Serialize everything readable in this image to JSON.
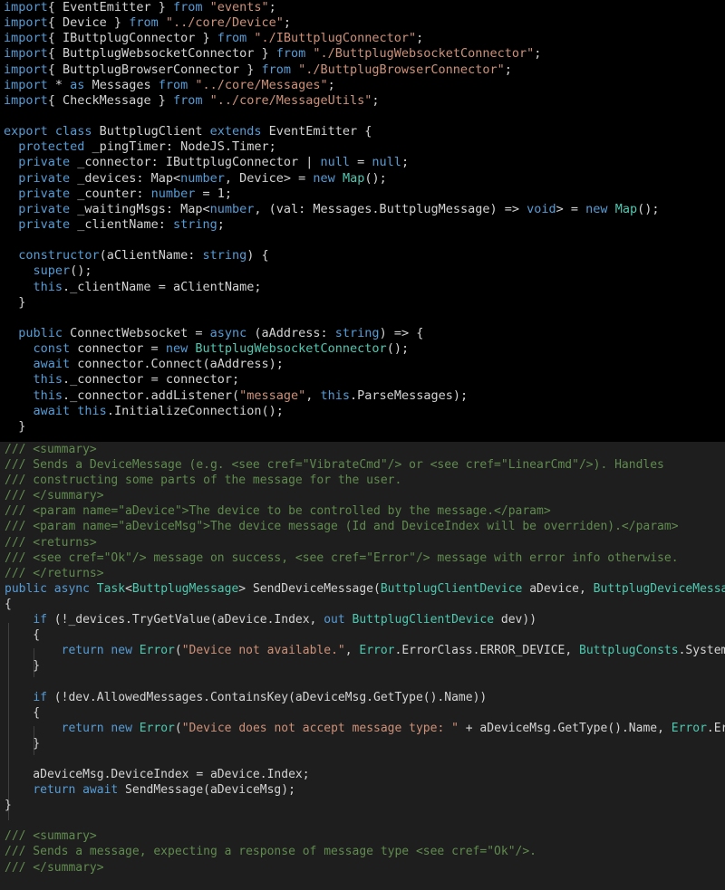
{
  "typescript": {
    "lines": [
      [
        [
          "kw",
          "import"
        ],
        [
          "",
          "{ EventEmitter } "
        ],
        [
          "kw",
          "from"
        ],
        [
          "str",
          " \"events\""
        ],
        [
          "",
          ";"
        ]
      ],
      [
        [
          "kw",
          "import"
        ],
        [
          "",
          "{ Device } "
        ],
        [
          "kw",
          "from"
        ],
        [
          "str",
          " \"../core/Device\""
        ],
        [
          "",
          ";"
        ]
      ],
      [
        [
          "kw",
          "import"
        ],
        [
          "",
          "{ IButtplugConnector } "
        ],
        [
          "kw",
          "from"
        ],
        [
          "str",
          " \"./IButtplugConnector\""
        ],
        [
          "",
          ";"
        ]
      ],
      [
        [
          "kw",
          "import"
        ],
        [
          "",
          "{ ButtplugWebsocketConnector } "
        ],
        [
          "kw",
          "from"
        ],
        [
          "str",
          " \"./ButtplugWebsocketConnector\""
        ],
        [
          "",
          ";"
        ]
      ],
      [
        [
          "kw",
          "import"
        ],
        [
          "",
          "{ ButtplugBrowserConnector } "
        ],
        [
          "kw",
          "from"
        ],
        [
          "str",
          " \"./ButtplugBrowserConnector\""
        ],
        [
          "",
          ";"
        ]
      ],
      [
        [
          "kw",
          "import"
        ],
        [
          "",
          " * "
        ],
        [
          "kw",
          "as"
        ],
        [
          "",
          " Messages "
        ],
        [
          "kw",
          "from"
        ],
        [
          "str",
          " \"../core/Messages\""
        ],
        [
          "",
          ";"
        ]
      ],
      [
        [
          "kw",
          "import"
        ],
        [
          "",
          "{ CheckMessage } "
        ],
        [
          "kw",
          "from"
        ],
        [
          "str",
          " \"../core/MessageUtils\""
        ],
        [
          "",
          ";"
        ]
      ],
      [],
      [
        [
          "kw",
          "export class"
        ],
        [
          "",
          " ButtplugClient "
        ],
        [
          "kw",
          "extends"
        ],
        [
          "",
          " EventEmitter {"
        ]
      ],
      [
        [
          "",
          "  "
        ],
        [
          "kw",
          "protected"
        ],
        [
          "",
          " _pingTimer: NodeJS.Timer;"
        ]
      ],
      [
        [
          "",
          "  "
        ],
        [
          "kw",
          "private"
        ],
        [
          "",
          " _connector: IButtplugConnector | "
        ],
        [
          "kw",
          "null"
        ],
        [
          "",
          " = "
        ],
        [
          "kw",
          "null"
        ],
        [
          "",
          ";"
        ]
      ],
      [
        [
          "",
          "  "
        ],
        [
          "kw",
          "private"
        ],
        [
          "",
          " _devices: Map<"
        ],
        [
          "kw",
          "number"
        ],
        [
          "",
          ", Device> = "
        ],
        [
          "kw",
          "new"
        ],
        [
          "",
          " "
        ],
        [
          "ty",
          "Map"
        ],
        [
          "",
          "();"
        ]
      ],
      [
        [
          "",
          "  "
        ],
        [
          "kw",
          "private"
        ],
        [
          "",
          " _counter: "
        ],
        [
          "kw",
          "number"
        ],
        [
          "",
          " = 1;"
        ]
      ],
      [
        [
          "",
          "  "
        ],
        [
          "kw",
          "private"
        ],
        [
          "",
          " _waitingMsgs: Map<"
        ],
        [
          "kw",
          "number"
        ],
        [
          "",
          ", (val: Messages.ButtplugMessage) => "
        ],
        [
          "kw",
          "void"
        ],
        [
          "",
          "> = "
        ],
        [
          "kw",
          "new"
        ],
        [
          "",
          " "
        ],
        [
          "ty",
          "Map"
        ],
        [
          "",
          "();"
        ]
      ],
      [
        [
          "",
          "  "
        ],
        [
          "kw",
          "private"
        ],
        [
          "",
          " _clientName: "
        ],
        [
          "kw",
          "string"
        ],
        [
          "",
          ";"
        ]
      ],
      [],
      [
        [
          "",
          "  "
        ],
        [
          "kw",
          "constructor"
        ],
        [
          "",
          "(aClientName: "
        ],
        [
          "kw",
          "string"
        ],
        [
          "",
          ") {"
        ]
      ],
      [
        [
          "",
          "    "
        ],
        [
          "kw",
          "super"
        ],
        [
          "",
          "();"
        ]
      ],
      [
        [
          "",
          "    "
        ],
        [
          "kw",
          "this"
        ],
        [
          "",
          "._clientName = aClientName;"
        ]
      ],
      [
        [
          "",
          "  }"
        ]
      ],
      [],
      [
        [
          "",
          "  "
        ],
        [
          "kw",
          "public"
        ],
        [
          "",
          " ConnectWebsocket = "
        ],
        [
          "kw",
          "async"
        ],
        [
          "",
          " (aAddress: "
        ],
        [
          "kw",
          "string"
        ],
        [
          "",
          ") => {"
        ]
      ],
      [
        [
          "",
          "    "
        ],
        [
          "kw",
          "const"
        ],
        [
          "",
          " connector = "
        ],
        [
          "kw",
          "new"
        ],
        [
          "",
          " "
        ],
        [
          "ty",
          "ButtplugWebsocketConnector"
        ],
        [
          "",
          "();"
        ]
      ],
      [
        [
          "",
          "    "
        ],
        [
          "kw",
          "await"
        ],
        [
          "",
          " connector.Connect(aAddress);"
        ]
      ],
      [
        [
          "",
          "    "
        ],
        [
          "kw",
          "this"
        ],
        [
          "",
          "._connector = connector;"
        ]
      ],
      [
        [
          "",
          "    "
        ],
        [
          "kw",
          "this"
        ],
        [
          "",
          "._connector.addListener("
        ],
        [
          "str",
          "\"message\""
        ],
        [
          "",
          ", "
        ],
        [
          "kw",
          "this"
        ],
        [
          "",
          ".ParseMessages);"
        ]
      ],
      [
        [
          "",
          "    "
        ],
        [
          "kw",
          "await"
        ],
        [
          "",
          " "
        ],
        [
          "kw",
          "this"
        ],
        [
          "",
          ".InitializeConnection();"
        ]
      ],
      [
        [
          "",
          "  }"
        ]
      ]
    ]
  },
  "csharp": {
    "lines": [
      [
        [
          "cm",
          "/// <summary>"
        ]
      ],
      [
        [
          "cm",
          "/// Sends a DeviceMessage (e.g. <see cref=\"VibrateCmd\"/> or <see cref=\"LinearCmd\"/>). Handles"
        ]
      ],
      [
        [
          "cm",
          "/// constructing some parts of the message for the user."
        ]
      ],
      [
        [
          "cm",
          "/// </summary>"
        ]
      ],
      [
        [
          "cm",
          "/// <param name=\"aDevice\">The device to be controlled by the message.</param>"
        ]
      ],
      [
        [
          "cm",
          "/// <param name=\"aDeviceMsg\">The device message (Id and DeviceIndex will be overriden).</param>"
        ]
      ],
      [
        [
          "cm",
          "/// <returns>"
        ]
      ],
      [
        [
          "cm",
          "/// <see cref=\"Ok\"/> message on success, <see cref=\"Error\"/> message with error info otherwise."
        ]
      ],
      [
        [
          "cm",
          "/// </returns>"
        ]
      ],
      [
        [
          "kw",
          "public async"
        ],
        [
          "",
          " "
        ],
        [
          "ty",
          "Task"
        ],
        [
          "",
          "<"
        ],
        [
          "ty",
          "ButtplugMessage"
        ],
        [
          "",
          "> SendDeviceMessage("
        ],
        [
          "ty",
          "ButtplugClientDevice"
        ],
        [
          "",
          " aDevice, "
        ],
        [
          "ty",
          "ButtplugDeviceMessage"
        ],
        [
          "",
          " aDeviceMsg)"
        ]
      ],
      [
        [
          "",
          "{"
        ]
      ],
      [
        [
          "",
          "    "
        ],
        [
          "kw",
          "if"
        ],
        [
          "",
          " (!_devices.TryGetValue(aDevice.Index, "
        ],
        [
          "kw",
          "out"
        ],
        [
          "",
          " "
        ],
        [
          "ty",
          "ButtplugClientDevice"
        ],
        [
          "",
          " dev))"
        ]
      ],
      [
        [
          "",
          "    {"
        ]
      ],
      [
        [
          "",
          "        "
        ],
        [
          "kw",
          "return new"
        ],
        [
          "",
          " "
        ],
        [
          "ty",
          "Error"
        ],
        [
          "",
          "("
        ],
        [
          "str",
          "\"Device not available.\""
        ],
        [
          "",
          ", "
        ],
        [
          "ty",
          "Error"
        ],
        [
          "",
          ".ErrorClass.ERROR_DEVICE, "
        ],
        [
          "ty",
          "ButtplugConsts"
        ],
        [
          "",
          ".SystemMsgId);"
        ]
      ],
      [
        [
          "",
          "    }"
        ]
      ],
      [],
      [
        [
          "",
          "    "
        ],
        [
          "kw",
          "if"
        ],
        [
          "",
          " (!dev.AllowedMessages.ContainsKey(aDeviceMsg.GetType().Name))"
        ]
      ],
      [
        [
          "",
          "    {"
        ]
      ],
      [
        [
          "",
          "        "
        ],
        [
          "kw",
          "return new"
        ],
        [
          "",
          " "
        ],
        [
          "ty",
          "Error"
        ],
        [
          "",
          "("
        ],
        [
          "str",
          "\"Device does not accept message type: \""
        ],
        [
          "",
          " + aDeviceMsg.GetType().Name, "
        ],
        [
          "ty",
          "Error"
        ],
        [
          "",
          ".ErrorClass.ERROR_DEVICE);"
        ]
      ],
      [
        [
          "",
          "    }"
        ]
      ],
      [],
      [
        [
          "",
          "    aDeviceMsg.DeviceIndex = aDevice.Index;"
        ]
      ],
      [
        [
          "",
          "    "
        ],
        [
          "kw",
          "return await"
        ],
        [
          "",
          " SendMessage(aDeviceMsg);"
        ]
      ],
      [
        [
          "",
          "}"
        ]
      ],
      [],
      [
        [
          "cm",
          "/// <summary>"
        ]
      ],
      [
        [
          "cm",
          "/// Sends a message, expecting a response of message type <see cref=\"Ok\"/>."
        ]
      ],
      [
        [
          "cm",
          "/// </summary>"
        ]
      ]
    ]
  }
}
